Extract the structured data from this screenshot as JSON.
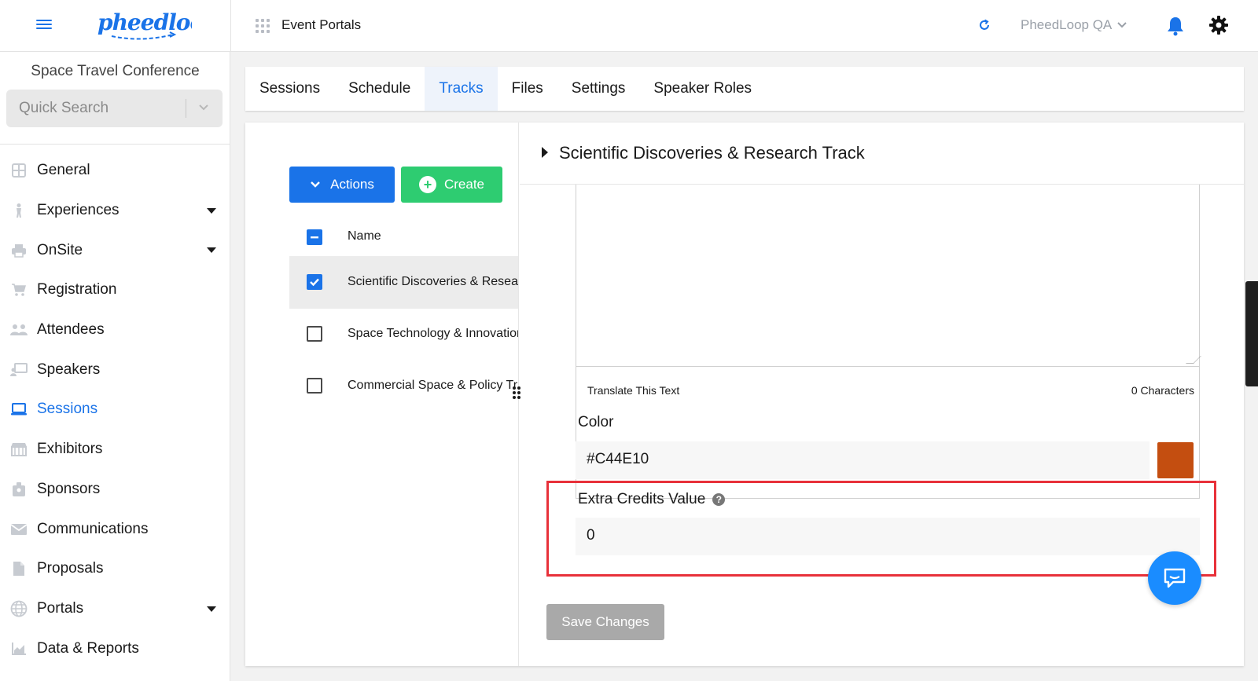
{
  "header": {
    "logo_text": "pheedloop",
    "portal_title": "Event Portals",
    "account_name": "PheedLoop QA"
  },
  "sidebar": {
    "event_name": "Space Travel Conference",
    "search_placeholder": "Quick Search",
    "items": [
      {
        "label": "General",
        "icon": "grid-icon"
      },
      {
        "label": "Experiences",
        "icon": "person-icon",
        "expandable": true
      },
      {
        "label": "OnSite",
        "icon": "printer-icon",
        "expandable": true
      },
      {
        "label": "Registration",
        "icon": "cart-icon"
      },
      {
        "label": "Attendees",
        "icon": "people-icon"
      },
      {
        "label": "Speakers",
        "icon": "presenter-icon"
      },
      {
        "label": "Sessions",
        "icon": "laptop-icon",
        "active": true
      },
      {
        "label": "Exhibitors",
        "icon": "store-icon"
      },
      {
        "label": "Sponsors",
        "icon": "badge-icon"
      },
      {
        "label": "Communications",
        "icon": "mail-icon"
      },
      {
        "label": "Proposals",
        "icon": "document-icon"
      },
      {
        "label": "Portals",
        "icon": "globe-icon",
        "expandable": true
      },
      {
        "label": "Data & Reports",
        "icon": "chart-icon"
      }
    ]
  },
  "tabs": [
    {
      "label": "Sessions"
    },
    {
      "label": "Schedule"
    },
    {
      "label": "Tracks",
      "active": true
    },
    {
      "label": "Files"
    },
    {
      "label": "Settings"
    },
    {
      "label": "Speaker Roles"
    }
  ],
  "list": {
    "actions_label": "Actions",
    "create_label": "Create",
    "column_name": "Name",
    "rows": [
      {
        "name": "Scientific Discoveries & Research Track",
        "checked": true
      },
      {
        "name": "Space Technology & Innovation Track",
        "checked": false
      },
      {
        "name": "Commercial Space & Policy Track",
        "checked": false
      }
    ]
  },
  "detail": {
    "track_title": "Scientific Discoveries & Research Track",
    "translate_label": "Translate This Text",
    "char_count": "0 Characters",
    "color_label": "Color",
    "color_value": "#C44E10",
    "swatch_color": "#C44E10",
    "credits_label": "Extra Credits Value",
    "credits_value": "0",
    "save_label": "Save Changes"
  },
  "colors": {
    "accent": "#1a73e8",
    "create_green": "#2ecc71",
    "highlight_red": "#e8313a"
  }
}
